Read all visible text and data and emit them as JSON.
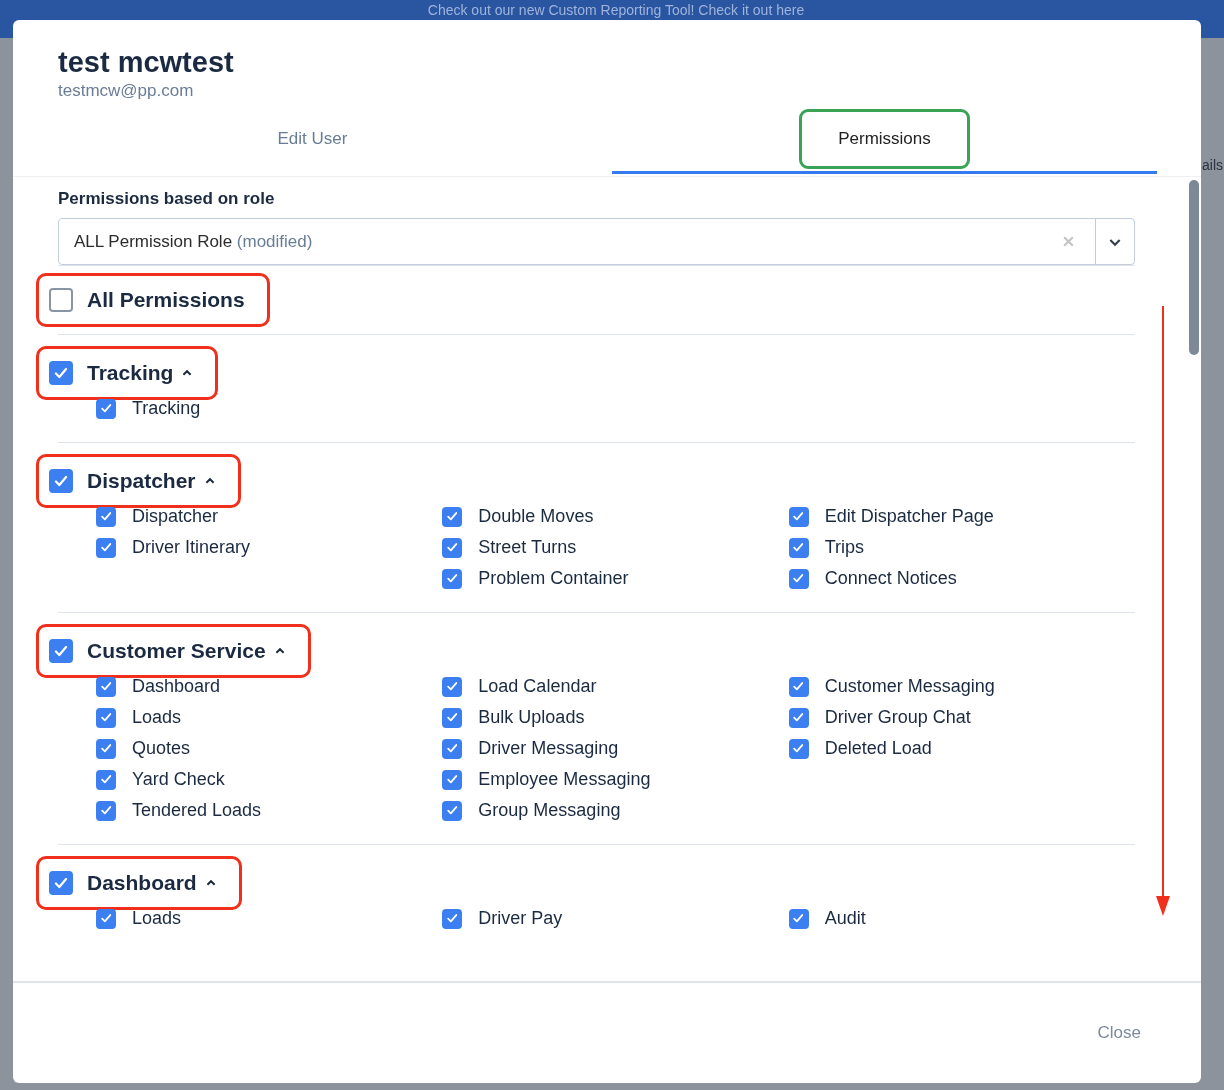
{
  "banner": {
    "text": "Check out our new Custom Reporting Tool!  Check it out here"
  },
  "background": {
    "side_label": "ails"
  },
  "user": {
    "name": "test mcwtest",
    "email": "testmcw@pp.com"
  },
  "tabs": [
    {
      "label": "Edit User",
      "selected": false,
      "highlighted": false
    },
    {
      "label": "Permissions",
      "selected": true,
      "highlighted": true
    }
  ],
  "role": {
    "label": "Permissions based on role",
    "value": "ALL Permission Role",
    "note": "(modified)"
  },
  "all_permissions": {
    "label": "All Permissions",
    "checked": false,
    "highlighted": true
  },
  "groups": [
    {
      "label": "Tracking",
      "checked": true,
      "expanded": true,
      "highlighted": true,
      "columns": [
        [
          {
            "label": "Tracking",
            "checked": true
          }
        ]
      ]
    },
    {
      "label": "Dispatcher",
      "checked": true,
      "expanded": true,
      "highlighted": true,
      "columns": [
        [
          {
            "label": "Dispatcher",
            "checked": true
          },
          {
            "label": "Driver Itinerary",
            "checked": true
          }
        ],
        [
          {
            "label": "Double Moves",
            "checked": true
          },
          {
            "label": "Street Turns",
            "checked": true
          },
          {
            "label": "Problem Container",
            "checked": true
          }
        ],
        [
          {
            "label": "Edit Dispatcher Page",
            "checked": true
          },
          {
            "label": "Trips",
            "checked": true
          },
          {
            "label": "Connect Notices",
            "checked": true
          }
        ]
      ]
    },
    {
      "label": "Customer Service",
      "checked": true,
      "expanded": true,
      "highlighted": true,
      "columns": [
        [
          {
            "label": "Dashboard",
            "checked": true
          },
          {
            "label": "Loads",
            "checked": true
          },
          {
            "label": "Quotes",
            "checked": true
          },
          {
            "label": "Yard Check",
            "checked": true
          },
          {
            "label": "Tendered Loads",
            "checked": true
          }
        ],
        [
          {
            "label": "Load Calendar",
            "checked": true
          },
          {
            "label": "Bulk Uploads",
            "checked": true
          },
          {
            "label": "Driver Messaging",
            "checked": true
          },
          {
            "label": "Employee Messaging",
            "checked": true
          },
          {
            "label": "Group Messaging",
            "checked": true
          }
        ],
        [
          {
            "label": "Customer Messaging",
            "checked": true
          },
          {
            "label": "Driver Group Chat",
            "checked": true
          },
          {
            "label": "Deleted Load",
            "checked": true
          }
        ]
      ]
    },
    {
      "label": "Dashboard",
      "checked": true,
      "expanded": true,
      "highlighted": true,
      "columns": [
        [
          {
            "label": "Loads",
            "checked": true
          }
        ],
        [
          {
            "label": "Driver Pay",
            "checked": true
          }
        ],
        [
          {
            "label": "Audit",
            "checked": true
          }
        ]
      ]
    }
  ],
  "scroll_arrow": true,
  "footer": {
    "close": "Close"
  }
}
